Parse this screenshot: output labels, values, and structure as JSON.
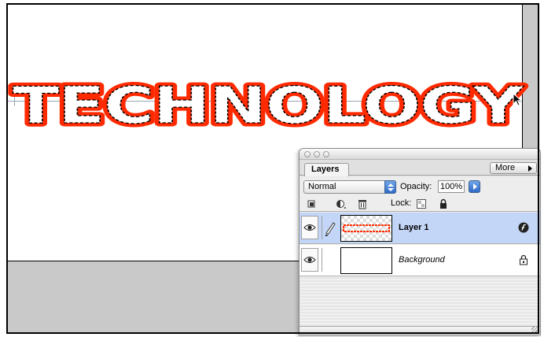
{
  "canvas": {
    "text": "TECHNOLOGY",
    "text_fill_color": "#ff2a00",
    "selection_outline_color": "#000000"
  },
  "layers_panel": {
    "tab_label": "Layers",
    "more_label": "More",
    "blend_mode": "Normal",
    "opacity_label": "Opacity:",
    "opacity_value": "100%",
    "lock_label": "Lock:",
    "layers": [
      {
        "name": "Layer 1",
        "selected": true,
        "has_effects": true
      },
      {
        "name": "Background",
        "selected": false,
        "locked": true
      }
    ]
  },
  "colors": {
    "selection_highlight": "#c3d6f7",
    "accent_blue": "#2f6bc9",
    "bg_gray": "#c9c9c9"
  }
}
